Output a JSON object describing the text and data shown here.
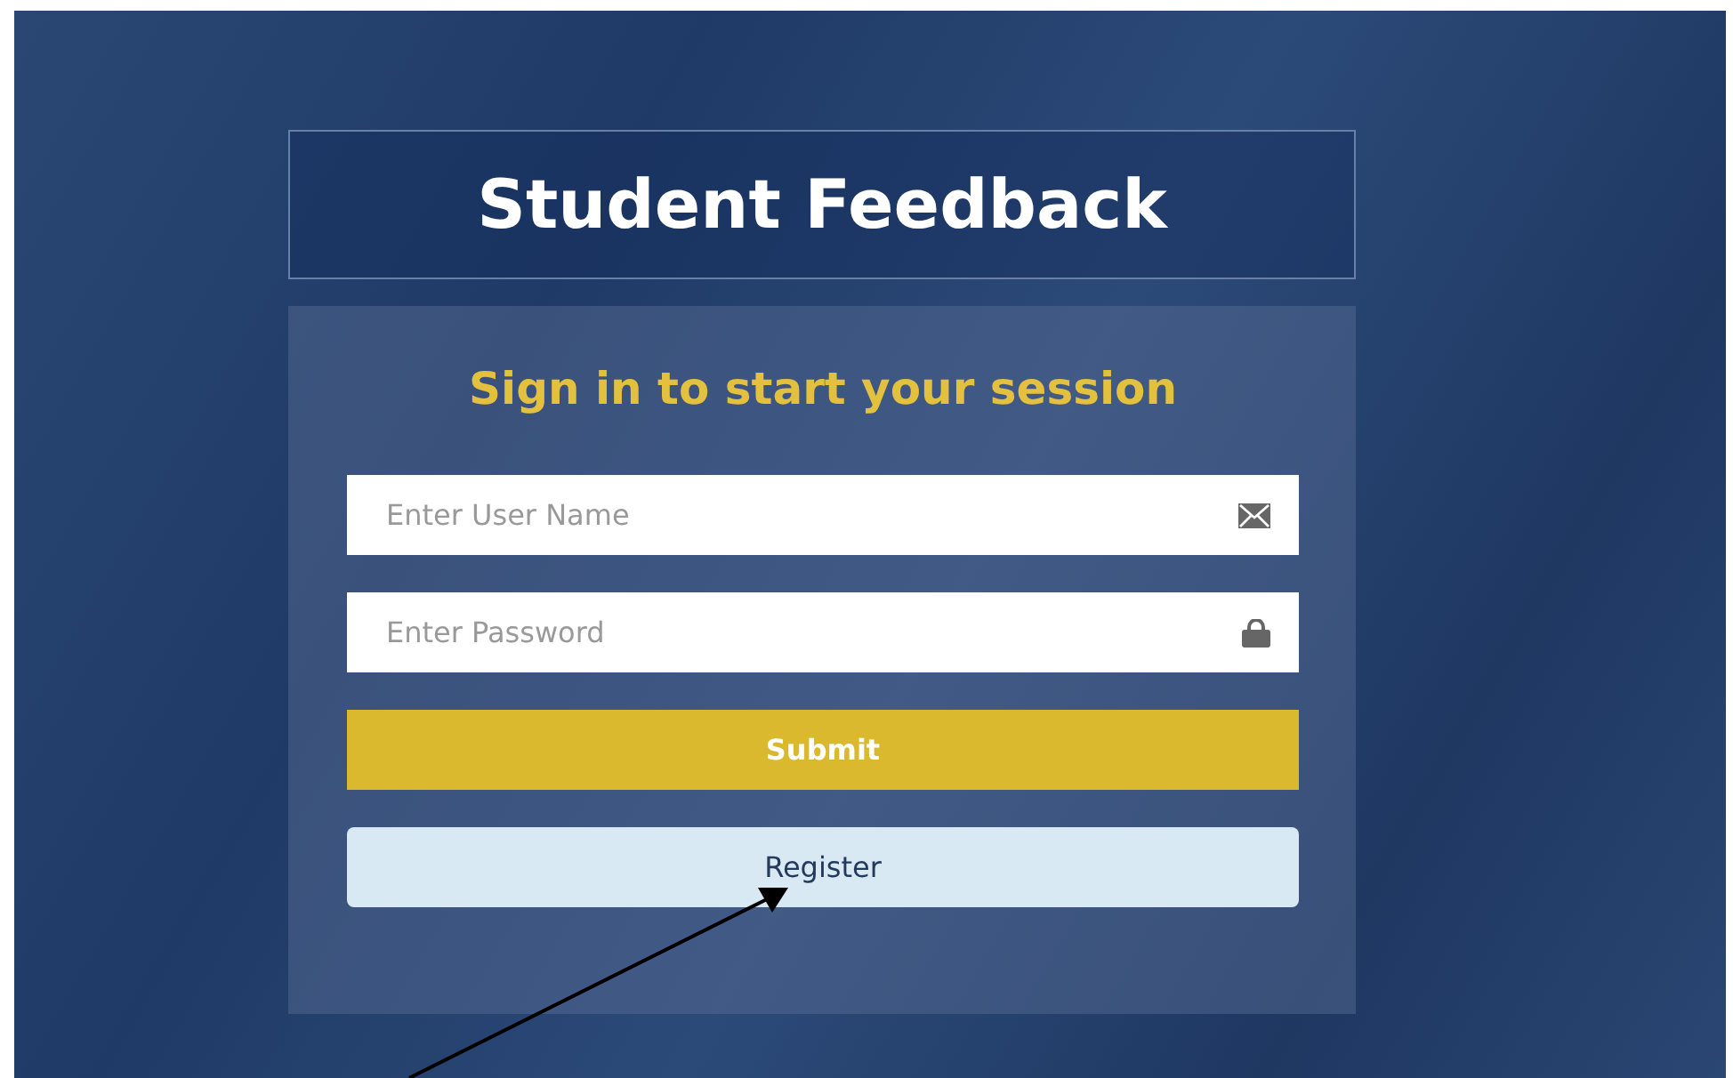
{
  "app_title": "Student Feedback",
  "login_card": {
    "heading": "Sign in to start your session",
    "fields": [
      {
        "kind": "email",
        "placeholder": "Enter User Name"
      },
      {
        "kind": "password",
        "placeholder": "Enter Password"
      }
    ],
    "buttons": [
      {
        "kind": "primary",
        "label": "Submit"
      },
      {
        "kind": "secondary",
        "label": "Register"
      }
    ]
  }
}
